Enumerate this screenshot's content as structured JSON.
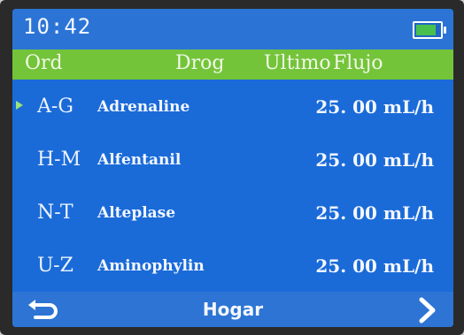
{
  "status": {
    "time": "10:42",
    "battery_level": 0.85,
    "battery_color": "#47c04e"
  },
  "header": {
    "ord": "Ord",
    "drog": "Drog",
    "ultimo": "Ultimo",
    "flujo": "Flujo"
  },
  "rows": [
    {
      "ord": "A-G",
      "drug": "Adrenaline",
      "flow": "25. 00 mL/h",
      "selected": true
    },
    {
      "ord": "H-M",
      "drug": "Alfentanil",
      "flow": "25. 00 mL/h",
      "selected": false
    },
    {
      "ord": "N-T",
      "drug": "Alteplase",
      "flow": "25. 00 mL/h",
      "selected": false
    },
    {
      "ord": "U-Z",
      "drug": "Aminophylin",
      "flow": "25. 00 mL/h",
      "selected": false
    }
  ],
  "footer": {
    "back_icon": "back-arrow-icon",
    "home_label": "Hogar",
    "next_icon": "chevron-right-icon"
  },
  "colors": {
    "screen": "#1a6bd8",
    "header": "#74c43a",
    "marker": "#9be37a"
  }
}
